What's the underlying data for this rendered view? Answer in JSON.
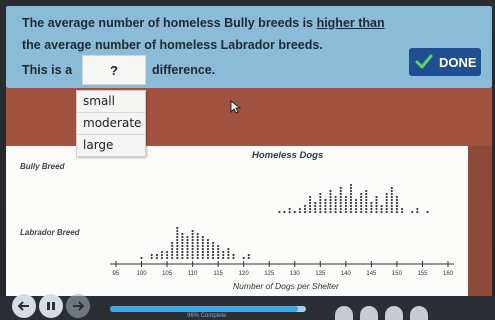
{
  "question": {
    "line1_part1": "The average number of homeless Bully breeds is",
    "line1_highlight": "higher than",
    "line2": "the average number of homeless Labrador breeds.",
    "line3_pre": "This is a",
    "blank_value": "?",
    "line3_post": "difference."
  },
  "done_button": {
    "label": "DONE"
  },
  "dropdown": {
    "options": [
      "small",
      "moderate",
      "large"
    ]
  },
  "progress": {
    "label": "96% Complete",
    "percent": 96
  },
  "chart_data": {
    "type": "scatter",
    "title": "Homeless Dogs",
    "xlabel": "Number of Dogs per Shelter",
    "ylabel": "",
    "categories": [
      "Bully Breed",
      "Labrador Breed"
    ],
    "x_ticks": [
      "95",
      "100",
      "105",
      "110",
      "115",
      "120",
      "125",
      "130",
      "135",
      "140",
      "145",
      "150",
      "155",
      "160"
    ],
    "xlim": [
      95,
      160
    ],
    "grid": false,
    "series": [
      {
        "name": "Bully Breed",
        "values": [
          {
            "x": 127,
            "count": 1
          },
          {
            "x": 128,
            "count": 1
          },
          {
            "x": 129,
            "count": 2
          },
          {
            "x": 130,
            "count": 1
          },
          {
            "x": 131,
            "count": 2
          },
          {
            "x": 132,
            "count": 3
          },
          {
            "x": 133,
            "count": 6
          },
          {
            "x": 134,
            "count": 4
          },
          {
            "x": 135,
            "count": 7
          },
          {
            "x": 136,
            "count": 5
          },
          {
            "x": 137,
            "count": 8
          },
          {
            "x": 138,
            "count": 6
          },
          {
            "x": 139,
            "count": 9
          },
          {
            "x": 140,
            "count": 6
          },
          {
            "x": 141,
            "count": 10
          },
          {
            "x": 142,
            "count": 5
          },
          {
            "x": 143,
            "count": 7
          },
          {
            "x": 144,
            "count": 8
          },
          {
            "x": 145,
            "count": 4
          },
          {
            "x": 146,
            "count": 6
          },
          {
            "x": 147,
            "count": 3
          },
          {
            "x": 148,
            "count": 7
          },
          {
            "x": 149,
            "count": 9
          },
          {
            "x": 150,
            "count": 6
          },
          {
            "x": 151,
            "count": 2
          },
          {
            "x": 153,
            "count": 1
          },
          {
            "x": 154,
            "count": 2
          },
          {
            "x": 156,
            "count": 1
          }
        ]
      },
      {
        "name": "Labrador Breed",
        "values": [
          {
            "x": 100,
            "count": 1
          },
          {
            "x": 102,
            "count": 2
          },
          {
            "x": 103,
            "count": 2
          },
          {
            "x": 104,
            "count": 3
          },
          {
            "x": 105,
            "count": 3
          },
          {
            "x": 106,
            "count": 6
          },
          {
            "x": 107,
            "count": 11
          },
          {
            "x": 108,
            "count": 9
          },
          {
            "x": 109,
            "count": 8
          },
          {
            "x": 110,
            "count": 10
          },
          {
            "x": 111,
            "count": 9
          },
          {
            "x": 112,
            "count": 8
          },
          {
            "x": 113,
            "count": 7
          },
          {
            "x": 114,
            "count": 6
          },
          {
            "x": 115,
            "count": 5
          },
          {
            "x": 116,
            "count": 3
          },
          {
            "x": 117,
            "count": 4
          },
          {
            "x": 118,
            "count": 2
          },
          {
            "x": 120,
            "count": 1
          },
          {
            "x": 121,
            "count": 2
          }
        ]
      }
    ]
  },
  "colors": {
    "prompt_bg": "#8bbbd6",
    "band": "#a2533f",
    "done": "#1f4e92",
    "dot": "#3d3d3d",
    "progress_fill": "#3fa6e4"
  },
  "icons": {
    "back": "arrow-left-icon",
    "pause": "pause-icon",
    "forward": "arrow-right-icon",
    "check": "check-icon",
    "cursor": "mouse-cursor-icon"
  }
}
